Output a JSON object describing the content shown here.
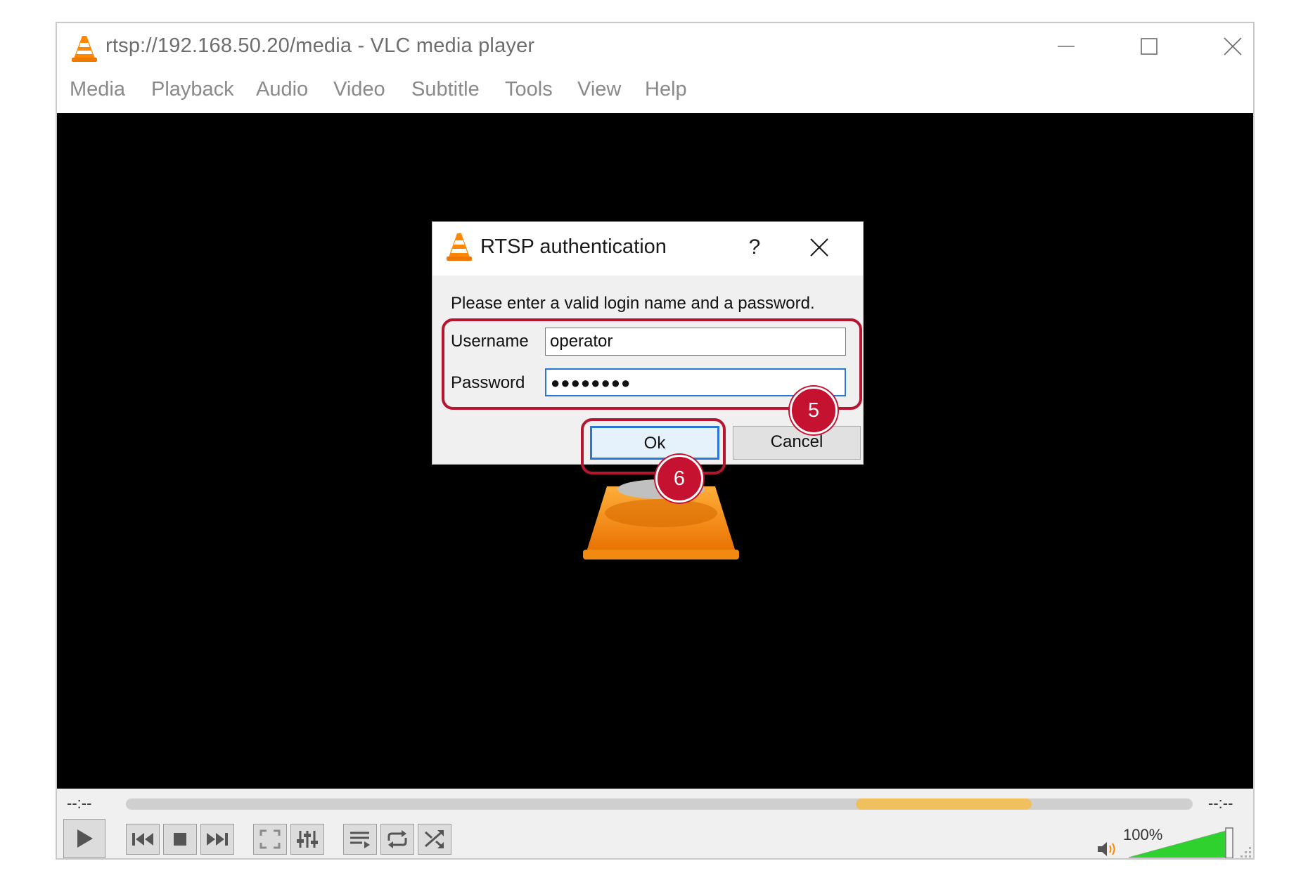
{
  "window": {
    "title": "rtsp://192.168.50.20/media - VLC media player",
    "icon": "vlc-cone-icon"
  },
  "menu": [
    "Media",
    "Playback",
    "Audio",
    "Video",
    "Subtitle",
    "Tools",
    "View",
    "Help"
  ],
  "dialog": {
    "title": "RTSP authentication",
    "help_label": "?",
    "message": "Please enter a valid login name and a password.",
    "username_label": "Username",
    "username_value": "operator",
    "password_label": "Password",
    "password_value": "●●●●●●●●",
    "ok_label": "Ok",
    "cancel_label": "Cancel"
  },
  "annotations": {
    "step_fields": "5",
    "step_ok": "6",
    "highlight_color": "#b5152f"
  },
  "playback": {
    "elapsed": "--:--",
    "remaining": "--:--",
    "volume_label": "100%",
    "volume_level": 1.0,
    "seek_buffer_color": "#f0c05e"
  },
  "colors": {
    "accent": "#ff8800",
    "focus": "#2a78d4",
    "volume": "#2ed12e"
  }
}
